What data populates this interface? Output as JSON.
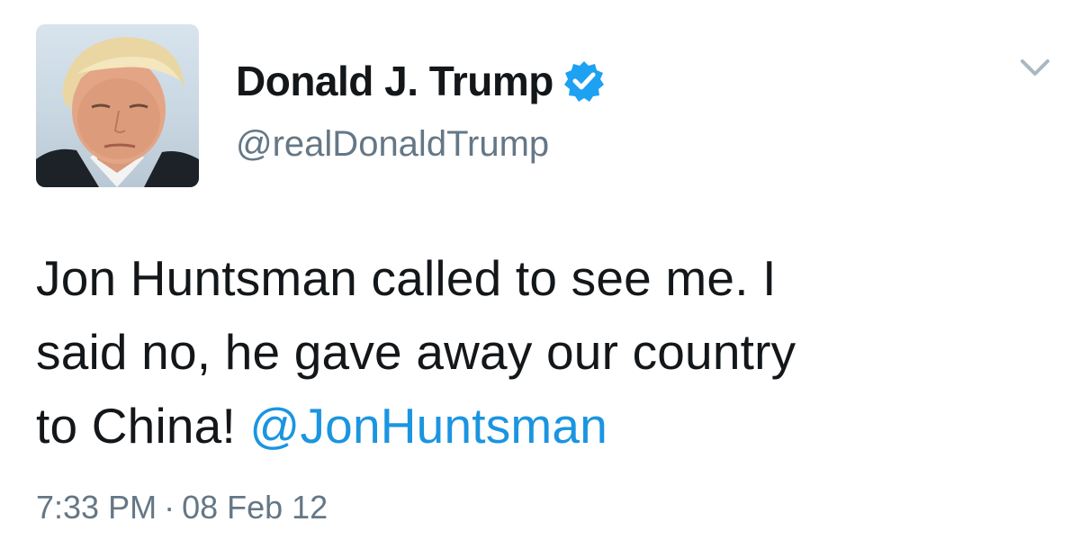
{
  "tweet": {
    "author": {
      "display_name": "Donald J. Trump",
      "handle": "@realDonaldTrump",
      "verified": true,
      "avatar_icon": "profile-photo"
    },
    "text": {
      "line1": "Jon Huntsman called to see me. I",
      "line2": "said no, he gave away our country",
      "line3_prefix": "to China! ",
      "mention": "@JonHuntsman"
    },
    "time": "7:33 PM",
    "separator": "·",
    "date": "08 Feb 12",
    "menu_icon": "chevron-down-icon"
  },
  "colors": {
    "text_primary": "#14171a",
    "text_secondary": "#657786",
    "link": "#1b95e0",
    "verified_badge": "#1da1f2",
    "background": "#ffffff"
  }
}
